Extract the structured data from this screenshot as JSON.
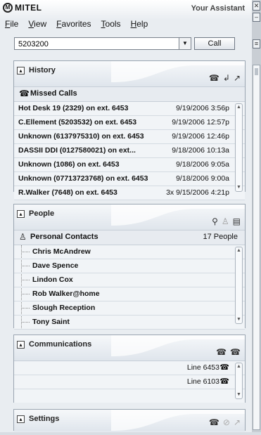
{
  "app": {
    "brand": "MITEL",
    "title": "Your Assistant"
  },
  "menu": [
    {
      "label": "File",
      "u": "F",
      "rest": "ile"
    },
    {
      "label": "View",
      "u": "V",
      "rest": "iew"
    },
    {
      "label": "Favorites",
      "u": "F",
      "rest": "avorites",
      "pre": ""
    },
    {
      "label": "Tools",
      "u": "T",
      "rest": "ools"
    },
    {
      "label": "Help",
      "u": "H",
      "rest": "elp"
    }
  ],
  "dial": {
    "value": "5203200",
    "call_label": "Call"
  },
  "history": {
    "title": "History",
    "sub_title": "Missed Calls",
    "rows": [
      {
        "name": "Hot Desk 19 (2329) on ext. 6453",
        "time": "9/19/2006 3:56p"
      },
      {
        "name": "C.Ellement (5203532) on ext. 6453",
        "time": "9/19/2006 12:57p"
      },
      {
        "name": "Unknown (6137975310) on ext. 6453",
        "time": "9/19/2006 12:46p"
      },
      {
        "name": "DASSII DDI (0127580021) on ext...",
        "time": "9/18/2006 10:13a"
      },
      {
        "name": "Unknown (1086) on ext. 6453",
        "time": "9/18/2006 9:05a"
      },
      {
        "name": "Unknown (07713723768) on ext. 6453",
        "time": "9/18/2006 9:00a"
      },
      {
        "name": "R.Walker (7648) on ext. 6453",
        "time": "3x 9/15/2006 4:21p"
      }
    ]
  },
  "people": {
    "title": "People",
    "sub_title": "Personal Contacts",
    "count": "17 People",
    "contacts": [
      "Chris McAndrew",
      "Dave Spence",
      "Lindon Cox",
      "Rob Walker@home",
      "Slough Reception",
      "Tony Saint"
    ]
  },
  "communications": {
    "title": "Communications",
    "lines": [
      "Line 6453",
      "Line 6103"
    ]
  },
  "settings": {
    "title": "Settings"
  }
}
